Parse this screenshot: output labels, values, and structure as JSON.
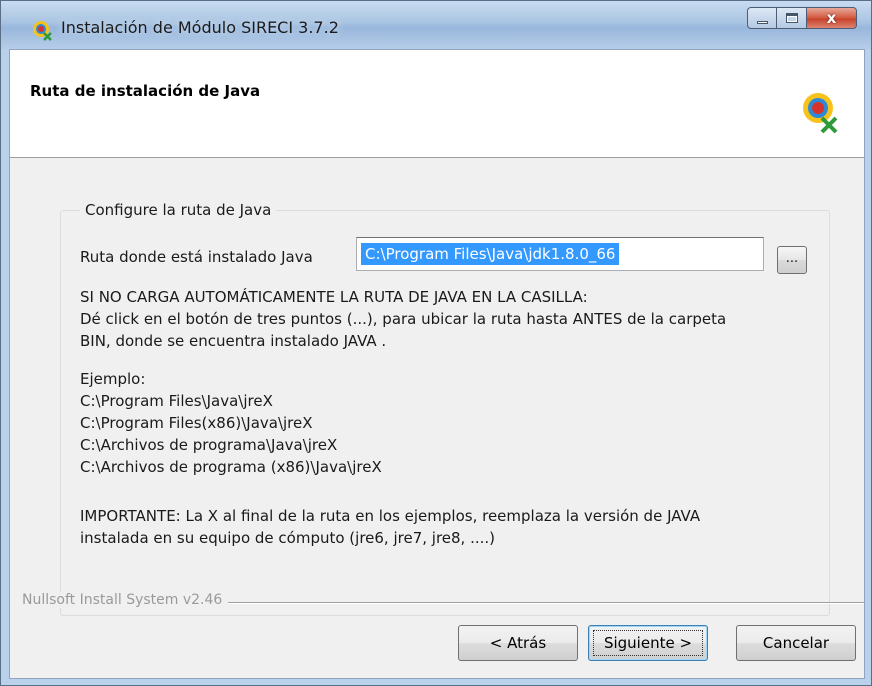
{
  "window": {
    "title": "Instalación de Módulo SIRECI 3.7.2",
    "close_label": "x"
  },
  "header": {
    "title": "Ruta de instalación de Java"
  },
  "group": {
    "caption": "Configure la ruta de Java",
    "path_label": "Ruta donde está instalado Java",
    "path_value": "C:\\Program Files\\Java\\jdk1.8.0_66",
    "browse_label": "..."
  },
  "info": {
    "block1": "SI NO CARGA AUTOMÁTICAMENTE LA RUTA DE JAVA EN LA CASILLA:\nDé click en el botón de tres puntos (...), para ubicar la ruta hasta ANTES de la carpeta\nBIN, donde se encuentra instalado JAVA .",
    "block2": "Ejemplo:\nC:\\Program Files\\Java\\jreX\nC:\\Program Files(x86)\\Java\\jreX\nC:\\Archivos de programa\\Java\\jreX\nC:\\Archivos de programa (x86)\\Java\\jreX",
    "block3": "IMPORTANTE: La X al final de la ruta en los ejemplos, reemplaza la versión de JAVA\ninstalada en su equipo de cómputo (jre6, jre7, jre8, ....)"
  },
  "footer": {
    "nsis_label": "Nullsoft Install System v2.46",
    "back_label": "< Atrás",
    "next_label": "Siguiente >",
    "cancel_label": "Cancelar"
  },
  "colors": {
    "selection": "#3399ff",
    "close_button": "#c7432a"
  }
}
